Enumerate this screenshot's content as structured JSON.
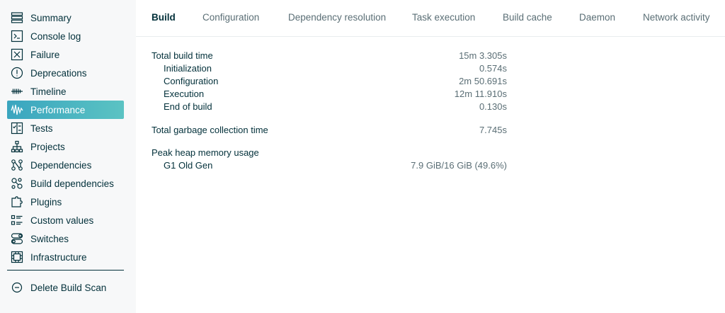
{
  "sidebar": {
    "items": [
      {
        "label": "Summary",
        "icon": "summary-icon"
      },
      {
        "label": "Console log",
        "icon": "console-icon"
      },
      {
        "label": "Failure",
        "icon": "failure-icon"
      },
      {
        "label": "Deprecations",
        "icon": "deprecation-icon"
      },
      {
        "label": "Timeline",
        "icon": "timeline-icon"
      },
      {
        "label": "Performance",
        "icon": "performance-icon",
        "active": true
      },
      {
        "label": "Tests",
        "icon": "tests-icon"
      },
      {
        "label": "Projects",
        "icon": "projects-icon"
      },
      {
        "label": "Dependencies",
        "icon": "dependencies-icon"
      },
      {
        "label": "Build dependencies",
        "icon": "build-dependencies-icon"
      },
      {
        "label": "Plugins",
        "icon": "plugins-icon"
      },
      {
        "label": "Custom values",
        "icon": "custom-values-icon"
      },
      {
        "label": "Switches",
        "icon": "switches-icon"
      },
      {
        "label": "Infrastructure",
        "icon": "infrastructure-icon"
      }
    ],
    "delete_label": "Delete Build Scan"
  },
  "tabs": [
    {
      "label": "Build",
      "active": true
    },
    {
      "label": "Configuration"
    },
    {
      "label": "Dependency resolution"
    },
    {
      "label": "Task execution"
    },
    {
      "label": "Build cache"
    },
    {
      "label": "Daemon"
    },
    {
      "label": "Network activity"
    }
  ],
  "metrics": {
    "total_build_time": {
      "label": "Total build time",
      "value": "15m 3.305s"
    },
    "initialization": {
      "label": "Initialization",
      "value": "0.574s"
    },
    "configuration": {
      "label": "Configuration",
      "value": "2m 50.691s"
    },
    "execution": {
      "label": "Execution",
      "value": "12m 11.910s"
    },
    "end_of_build": {
      "label": "End of build",
      "value": "0.130s"
    },
    "gc_time": {
      "label": "Total garbage collection time",
      "value": "7.745s"
    },
    "peak_heap": {
      "label": "Peak heap memory usage",
      "value": ""
    },
    "g1_old_gen": {
      "label": "G1 Old Gen",
      "value": "7.9 GiB/16 GiB (49.6%)"
    }
  },
  "colors": {
    "accent_start": "#3aa5bf",
    "accent_end": "#5bc3c3",
    "text": "#02303a",
    "muted": "#5a6e75"
  }
}
